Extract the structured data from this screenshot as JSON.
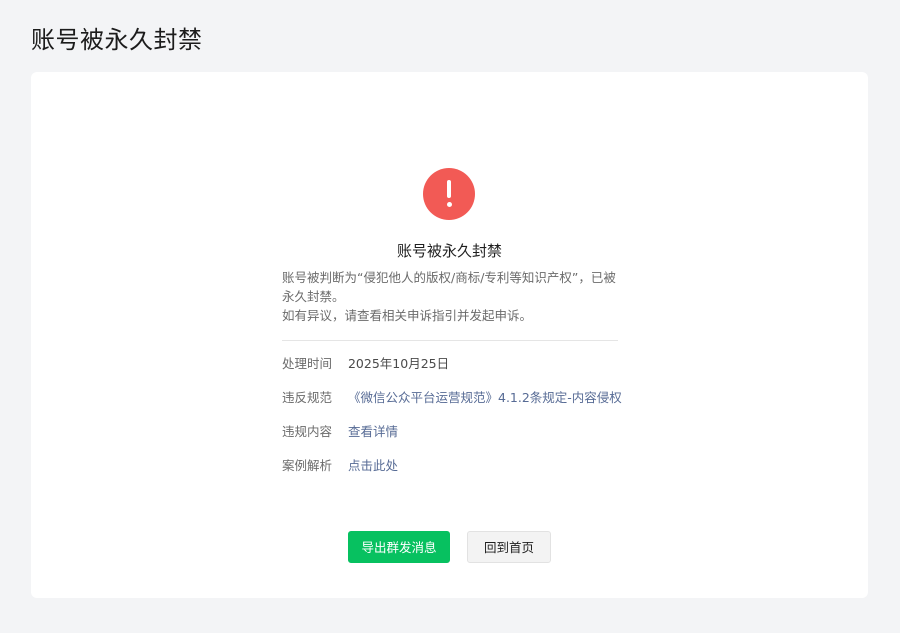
{
  "page": {
    "title": "账号被永久封禁"
  },
  "notice": {
    "title": "账号被永久封禁",
    "description_line1": "账号被判断为“侵犯他人的版权/商标/专利等知识产权”，已被",
    "description_line2": "永久封禁。",
    "description_line3": "如有异议，请查看相关申诉指引并发起申诉。"
  },
  "details": [
    {
      "label": "处理时间",
      "value": "2025年10月25日"
    },
    {
      "label": "违反规范",
      "value": "《微信公众平台运营规范》4.1.2条规定-内容侵权"
    },
    {
      "label": "违规内容",
      "value": "查看详情"
    },
    {
      "label": "案例解析",
      "value": "点击此处"
    }
  ],
  "actions": {
    "export_label": "导出群发消息",
    "home_label": "回到首页"
  },
  "colors": {
    "alert": "#f25a55",
    "primary": "#07c160",
    "link": "#576b95"
  },
  "icons": {
    "alert": "exclamation-circle-icon"
  }
}
